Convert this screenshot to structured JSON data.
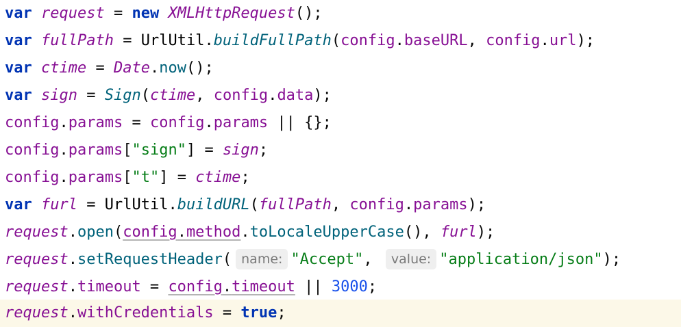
{
  "code": {
    "lines": [
      [
        {
          "cls": "kw",
          "text": "var"
        },
        {
          "cls": "pl",
          "text": " "
        },
        {
          "cls": "lv",
          "text": "request"
        },
        {
          "cls": "pl",
          "text": " = "
        },
        {
          "cls": "kw",
          "text": "new"
        },
        {
          "cls": "pl",
          "text": " "
        },
        {
          "cls": "cls-i",
          "text": "XMLHttpRequest"
        },
        {
          "cls": "pl",
          "text": "();"
        }
      ],
      [
        {
          "cls": "kw",
          "text": "var"
        },
        {
          "cls": "pl",
          "text": " "
        },
        {
          "cls": "lv",
          "text": "fullPath"
        },
        {
          "cls": "pl",
          "text": " = "
        },
        {
          "cls": "cls",
          "text": "UrlUtil"
        },
        {
          "cls": "pl",
          "text": "."
        },
        {
          "cls": "fni",
          "text": "buildFullPath"
        },
        {
          "cls": "pl",
          "text": "("
        },
        {
          "cls": "cfg",
          "text": "config"
        },
        {
          "cls": "pl",
          "text": "."
        },
        {
          "cls": "prop",
          "text": "baseURL"
        },
        {
          "cls": "pl",
          "text": ", "
        },
        {
          "cls": "cfg",
          "text": "config"
        },
        {
          "cls": "pl",
          "text": "."
        },
        {
          "cls": "prop",
          "text": "url"
        },
        {
          "cls": "pl",
          "text": ");"
        }
      ],
      [
        {
          "cls": "kw",
          "text": "var"
        },
        {
          "cls": "pl",
          "text": " "
        },
        {
          "cls": "lv",
          "text": "ctime"
        },
        {
          "cls": "pl",
          "text": " = "
        },
        {
          "cls": "cls-i",
          "text": "Date"
        },
        {
          "cls": "pl",
          "text": "."
        },
        {
          "cls": "fn",
          "text": "now"
        },
        {
          "cls": "pl",
          "text": "();"
        }
      ],
      [
        {
          "cls": "kw",
          "text": "var"
        },
        {
          "cls": "pl",
          "text": " "
        },
        {
          "cls": "lv",
          "text": "sign"
        },
        {
          "cls": "pl",
          "text": " = "
        },
        {
          "cls": "fni",
          "text": "Sign"
        },
        {
          "cls": "pl",
          "text": "("
        },
        {
          "cls": "lv",
          "text": "ctime"
        },
        {
          "cls": "pl",
          "text": ", "
        },
        {
          "cls": "cfg",
          "text": "config"
        },
        {
          "cls": "pl",
          "text": "."
        },
        {
          "cls": "prop",
          "text": "data"
        },
        {
          "cls": "pl",
          "text": ");"
        }
      ],
      [
        {
          "cls": "cfg",
          "text": "config"
        },
        {
          "cls": "pl",
          "text": "."
        },
        {
          "cls": "prop",
          "text": "params"
        },
        {
          "cls": "pl",
          "text": " = "
        },
        {
          "cls": "cfg",
          "text": "config"
        },
        {
          "cls": "pl",
          "text": "."
        },
        {
          "cls": "prop",
          "text": "params"
        },
        {
          "cls": "pl",
          "text": " || {};"
        }
      ],
      [
        {
          "cls": "cfg",
          "text": "config"
        },
        {
          "cls": "pl",
          "text": "."
        },
        {
          "cls": "prop",
          "text": "params"
        },
        {
          "cls": "pl",
          "text": "["
        },
        {
          "cls": "str",
          "text": "\"sign\""
        },
        {
          "cls": "pl",
          "text": "] = "
        },
        {
          "cls": "lv",
          "text": "sign"
        },
        {
          "cls": "pl",
          "text": ";"
        }
      ],
      [
        {
          "cls": "cfg",
          "text": "config"
        },
        {
          "cls": "pl",
          "text": "."
        },
        {
          "cls": "prop",
          "text": "params"
        },
        {
          "cls": "pl",
          "text": "["
        },
        {
          "cls": "str",
          "text": "\"t\""
        },
        {
          "cls": "pl",
          "text": "] = "
        },
        {
          "cls": "lv",
          "text": "ctime"
        },
        {
          "cls": "pl",
          "text": ";"
        }
      ],
      [
        {
          "cls": "kw",
          "text": "var"
        },
        {
          "cls": "pl",
          "text": " "
        },
        {
          "cls": "lv",
          "text": "furl"
        },
        {
          "cls": "pl",
          "text": " = "
        },
        {
          "cls": "cls",
          "text": "UrlUtil"
        },
        {
          "cls": "pl",
          "text": "."
        },
        {
          "cls": "fni",
          "text": "buildURL"
        },
        {
          "cls": "pl",
          "text": "("
        },
        {
          "cls": "lv",
          "text": "fullPath"
        },
        {
          "cls": "pl",
          "text": ", "
        },
        {
          "cls": "cfg",
          "text": "config"
        },
        {
          "cls": "pl",
          "text": "."
        },
        {
          "cls": "prop",
          "text": "params"
        },
        {
          "cls": "pl",
          "text": ");"
        }
      ],
      [
        {
          "cls": "lv",
          "text": "request"
        },
        {
          "cls": "pl",
          "text": "."
        },
        {
          "cls": "fn",
          "text": "open"
        },
        {
          "cls": "pl",
          "text": "("
        },
        {
          "cls": "cfg ul",
          "text": "config"
        },
        {
          "cls": "pl ul",
          "text": "."
        },
        {
          "cls": "prop ul",
          "text": "method"
        },
        {
          "cls": "pl",
          "text": "."
        },
        {
          "cls": "fn",
          "text": "toLocaleUpperCase"
        },
        {
          "cls": "pl",
          "text": "(), "
        },
        {
          "cls": "lv",
          "text": "furl"
        },
        {
          "cls": "pl",
          "text": ");"
        }
      ],
      [
        {
          "cls": "lv",
          "text": "request"
        },
        {
          "cls": "pl",
          "text": "."
        },
        {
          "cls": "fn",
          "text": "setRequestHeader"
        },
        {
          "cls": "pl",
          "text": "("
        },
        {
          "cls": "hint",
          "text": "name:"
        },
        {
          "cls": "str",
          "text": "\"Accept\""
        },
        {
          "cls": "pl",
          "text": ", "
        },
        {
          "cls": "hint",
          "text": "value:"
        },
        {
          "cls": "str",
          "text": "\"application/json\""
        },
        {
          "cls": "pl",
          "text": ");"
        }
      ],
      [
        {
          "cls": "lv",
          "text": "request"
        },
        {
          "cls": "pl",
          "text": "."
        },
        {
          "cls": "prop",
          "text": "timeout"
        },
        {
          "cls": "pl",
          "text": " = "
        },
        {
          "cls": "cfg ul",
          "text": "config"
        },
        {
          "cls": "pl ul",
          "text": "."
        },
        {
          "cls": "prop ul",
          "text": "timeout"
        },
        {
          "cls": "pl",
          "text": " || "
        },
        {
          "cls": "num",
          "text": "3000"
        },
        {
          "cls": "pl",
          "text": ";"
        }
      ],
      [
        {
          "cls": "lv",
          "text": "request"
        },
        {
          "cls": "pl",
          "text": "."
        },
        {
          "cls": "prop",
          "text": "withCredentials"
        },
        {
          "cls": "pl",
          "text": " = "
        },
        {
          "cls": "kw",
          "text": "true"
        },
        {
          "cls": "pl",
          "text": ";"
        }
      ]
    ]
  }
}
